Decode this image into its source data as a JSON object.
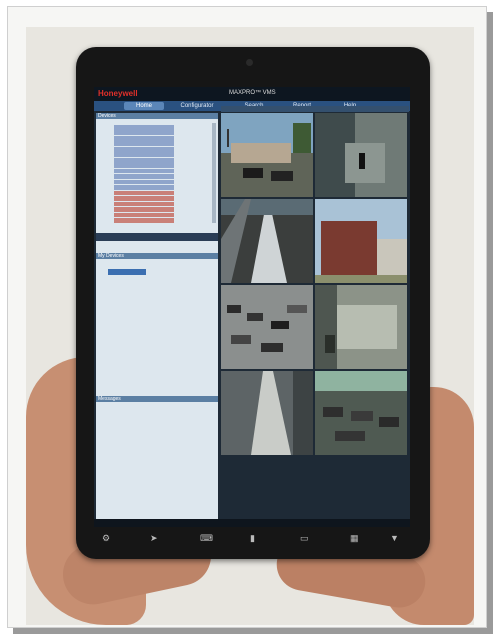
{
  "app": {
    "brand": "Honeywell",
    "title": "MAXPRO™ VMS"
  },
  "tabs": [
    "Home",
    "Configurator",
    "Search",
    "Report",
    "Help"
  ],
  "panes": {
    "devices": "Devices",
    "my_devices": "My Devices",
    "messages": "Messages"
  },
  "colors": {
    "brand_red": "#e0302a",
    "tab_blue": "#2a5180",
    "tab_active": "#5b86b8",
    "pane_bg": "#dde7ee"
  },
  "icons": [
    "gear-icon",
    "cursor-icon",
    "keyboard-icon",
    "camera-icon",
    "window-icon",
    "grid-icon",
    "chevron-down-icon"
  ]
}
